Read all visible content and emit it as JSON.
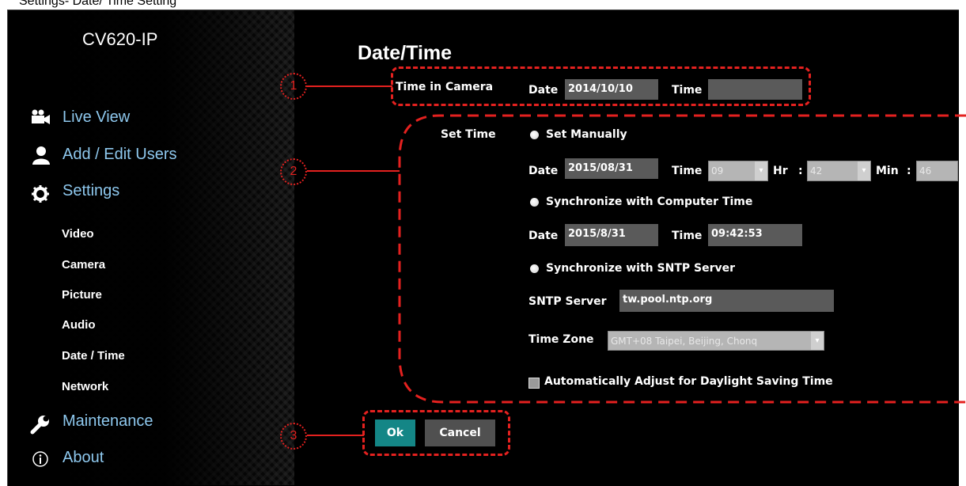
{
  "doc_caption": "Settings- Date/ Time Setting",
  "device": {
    "name": "CV620-IP"
  },
  "nav": {
    "live_view": "Live View",
    "add_edit_users": "Add / Edit Users",
    "settings": "Settings",
    "maintenance": "Maintenance",
    "about": "About",
    "sub_items": [
      "Video",
      "Camera",
      "Picture",
      "Audio",
      "Date / Time",
      "Network"
    ]
  },
  "page": {
    "title": "Date/Time",
    "time_in_camera": {
      "label": "Time in Camera",
      "date_label": "Date",
      "date_value": "2014/10/10",
      "time_label": "Time",
      "time_value": ""
    },
    "set_time": {
      "label": "Set Time",
      "manual": {
        "option_label": "Set Manually",
        "date_label": "Date",
        "date_value": "2015/08/31",
        "time_label": "Time",
        "hour_value": "09",
        "hr_label": "Hr",
        "colon": ":",
        "min_value": "42",
        "min_label": "Min",
        "sec_value": "46"
      },
      "sync_computer": {
        "option_label": "Synchronize with Computer Time",
        "date_label": "Date",
        "date_value": "2015/8/31",
        "time_label": "Time",
        "time_value": "09:42:53"
      },
      "sync_sntp": {
        "option_label": "Synchronize with SNTP Server",
        "server_label": "SNTP Server",
        "server_value": "tw.pool.ntp.org",
        "timezone_label": "Time Zone",
        "timezone_value": "GMT+08 Taipei, Beijing, Chonq"
      },
      "dst_label": "Automatically Adjust for Daylight Saving Time"
    },
    "buttons": {
      "ok": "Ok",
      "cancel": "Cancel"
    }
  },
  "callouts": [
    "1",
    "2",
    "3"
  ],
  "colors": {
    "accent_red": "#e4211f",
    "ok_button": "#148686",
    "nav_link": "#8ec8ee"
  }
}
